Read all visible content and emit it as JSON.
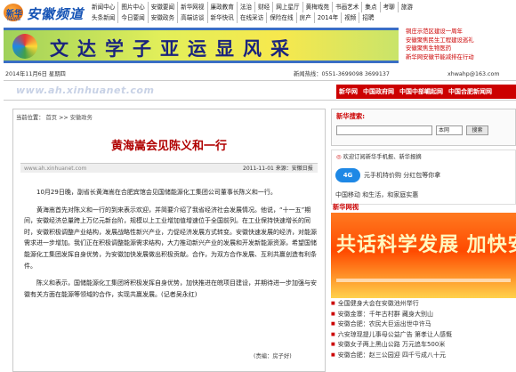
{
  "header": {
    "logo_small": "新华",
    "logo_sub": "NEWS",
    "brand": "安徽频道",
    "nav_rows": [
      [
        "新闻中心",
        "图片中心",
        "安徽要闻",
        "新华网视",
        "廉政教育",
        "法治",
        "财经",
        "网上星厅",
        "黄梅戏苑",
        "书画艺术",
        "集点",
        "考聊",
        "旅游"
      ],
      [
        "头条新闻",
        "今日要闻",
        "安徽政务",
        "高端访谈",
        "新华快讯",
        "在线采访",
        "保险在线",
        "房产",
        "2014年",
        "视频",
        "招聘"
      ]
    ]
  },
  "banner": {
    "title": "文达学子亚运显风采",
    "side_links": [
      "铜庄示范区建设一周年",
      "安徽聚焦民生工程建设巡礼",
      "安徽聚焦生物医药",
      "新华网安徽节能减排在行动"
    ]
  },
  "info": {
    "date": "2014年11月6日 星期四",
    "hotline": "新闻热线：0551-3699098  3699137",
    "email": "xhwahp@163.com"
  },
  "search_bar": {
    "url": "www.ah.xinhuanet.com",
    "tabs": [
      "新华网",
      "中国政府网",
      "中国中部崛起网",
      "中国合肥新闻网"
    ]
  },
  "article": {
    "breadcrumb": [
      "当前位置：",
      "首页",
      ">>",
      "安徽政务"
    ],
    "title": "黄海嵩会见陈义和一行",
    "source_url": "www.ah.xinhuanet.com",
    "date_source": "2011-11-01    来源：安徽日报",
    "paragraphs": [
      "10月29日晚，副省长黄海嵩在合肥宾馆会见国储能源化工集团公司董事长陈义和一行。",
      "黄海嵩首先对陈义和一行的到来表示欢迎，并简要介绍了我省经济社会发展情况。他说，“十一五”期间，安徽经济总量跨上万亿元新台阶，规模以上工业增加值增速位于全国前列。在工业保持快速增长的同时，安徽积极调整产业结构，发展战略性新兴产业，力促经济发展方式转变。安徽快速发展的经济，对能源需求进一步增加。我们正在积极调整能源需求结构，大力推动新兴产业的发展和开发新能源资源，希望国储能源化工集团发挥自身优势，为安徽加快发展做出积极贡献。合作，为双方合作发展、互利共赢创造有利条件。",
      "陈义和表示，国储能源化工集团将积极发挥自身优势，加快推进在皖项目建设，并期待进一步加强与安徽有关方面在能源等领域的合作，实现共赢发展。(记者吴永红)"
    ],
    "editor": "(责编：房子好)"
  },
  "right": {
    "search_label": "新华搜索:",
    "search_placeholder": "",
    "search_scope": "本网",
    "search_button": "搜索",
    "hot_text_1": "欢迎订阅新华手机报、",
    "hot_text_2": "新华报摘",
    "ad1_badge": "4G",
    "ad1_text": "元手机特价购  分红包等你拿",
    "ad2_text": "中国移动 和生活，和家庭实惠",
    "video_title": "新华网视",
    "poster_text": "共话科学发展 加快安徽崛起",
    "news": [
      "全国健身大会在安徽池州举行",
      "安徽金寨：千年古村群 藏身大别山",
      "安徽合肥：农民大巨运出世中许马",
      "六安琼现提儿事母公益广告 第孝让人感慨",
      "安徽女子两上黑山公路 万元追车500米",
      "安徽合肥：赵三公园迎 四千亏成八十元"
    ]
  }
}
